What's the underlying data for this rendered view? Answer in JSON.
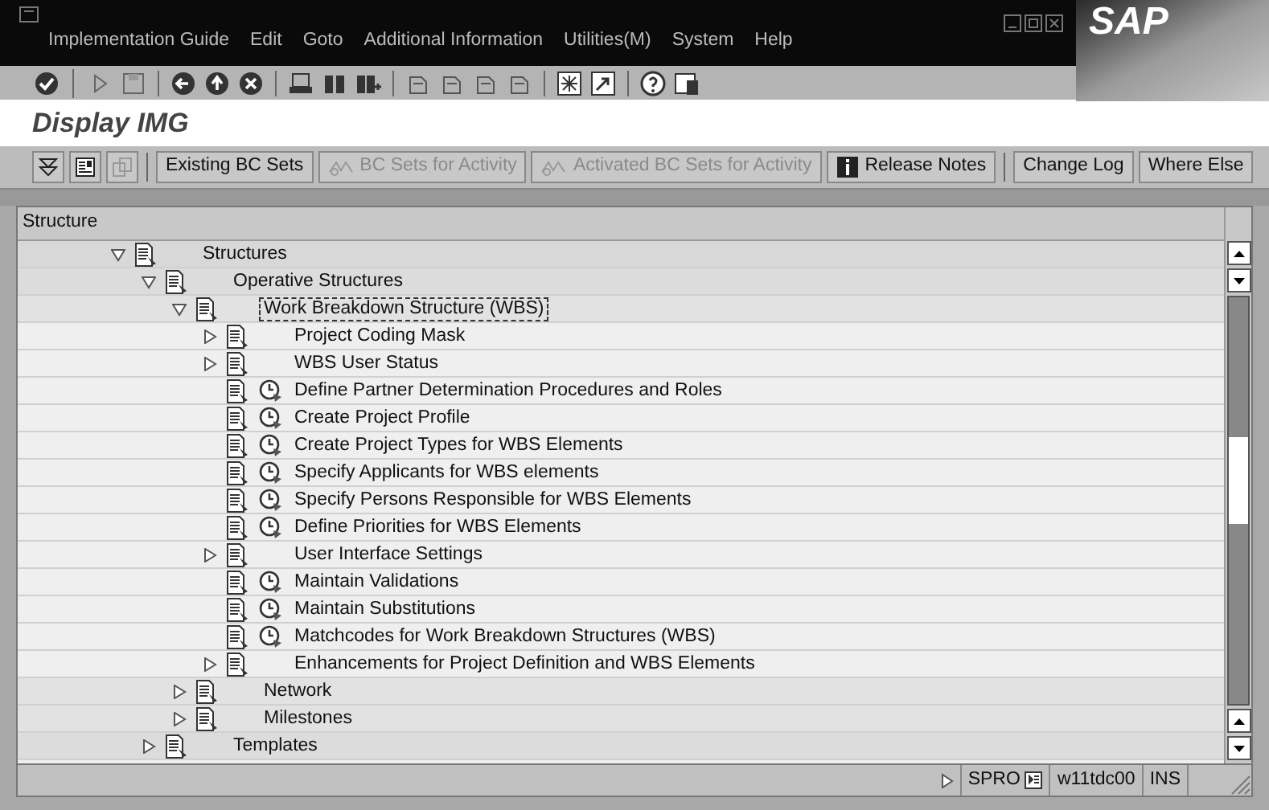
{
  "menu": [
    "Implementation Guide",
    "Edit",
    "Goto",
    "Additional Information",
    "Utilities(M)",
    "System",
    "Help"
  ],
  "logo": "SAP",
  "title": "Display IMG",
  "app_toolbar": [
    {
      "kind": "icon",
      "disabled": false
    },
    {
      "kind": "icon",
      "disabled": false
    },
    {
      "kind": "icon",
      "disabled": true
    },
    {
      "kind": "text",
      "label": "Existing BC Sets",
      "disabled": false
    },
    {
      "kind": "text",
      "label": "BC Sets for Activity",
      "disabled": true
    },
    {
      "kind": "text",
      "label": "Activated BC Sets for Activity",
      "disabled": true
    },
    {
      "kind": "text",
      "label": "Release Notes",
      "disabled": false
    },
    {
      "kind": "text",
      "label": "Change Log",
      "disabled": false
    },
    {
      "kind": "text",
      "label": "Where Else",
      "disabled": false
    }
  ],
  "tree": {
    "header": "Structure",
    "nodes": [
      {
        "label": "Structures",
        "kind": "folder",
        "expanded": true,
        "selected": false,
        "children": [
          {
            "label": "Operative Structures",
            "kind": "folder",
            "expanded": true,
            "selected": false,
            "children": [
              {
                "label": "Work Breakdown Structure (WBS)",
                "kind": "folder",
                "expanded": true,
                "selected": true,
                "children": [
                  {
                    "label": "Project Coding Mask",
                    "kind": "folder",
                    "expanded": false,
                    "selected": false
                  },
                  {
                    "label": "WBS User Status",
                    "kind": "folder",
                    "expanded": false,
                    "selected": false
                  },
                  {
                    "label": "Define Partner Determination Procedures and Roles",
                    "kind": "activity",
                    "selected": false
                  },
                  {
                    "label": "Create Project Profile",
                    "kind": "activity",
                    "selected": false
                  },
                  {
                    "label": "Create Project Types for WBS Elements",
                    "kind": "activity",
                    "selected": false
                  },
                  {
                    "label": "Specify Applicants for WBS elements",
                    "kind": "activity",
                    "selected": false
                  },
                  {
                    "label": "Specify Persons Responsible for WBS Elements",
                    "kind": "activity",
                    "selected": false
                  },
                  {
                    "label": "Define Priorities for WBS Elements",
                    "kind": "activity",
                    "selected": false
                  },
                  {
                    "label": "User Interface Settings",
                    "kind": "folder",
                    "expanded": false,
                    "selected": false
                  },
                  {
                    "label": "Maintain Validations",
                    "kind": "activity",
                    "selected": false
                  },
                  {
                    "label": "Maintain Substitutions",
                    "kind": "activity",
                    "selected": false
                  },
                  {
                    "label": "Matchcodes for Work Breakdown Structures (WBS)",
                    "kind": "activity",
                    "selected": false
                  },
                  {
                    "label": "Enhancements for Project Definition and WBS Elements",
                    "kind": "folder",
                    "expanded": false,
                    "selected": false
                  }
                ]
              },
              {
                "label": "Network",
                "kind": "folder",
                "expanded": false,
                "selected": false
              },
              {
                "label": "Milestones",
                "kind": "folder",
                "expanded": false,
                "selected": false
              }
            ]
          },
          {
            "label": "Templates",
            "kind": "folder",
            "expanded": false,
            "selected": false
          }
        ]
      }
    ]
  },
  "status_bar": {
    "transaction": "SPRO",
    "server": "w11tdc00",
    "mode": "INS"
  }
}
